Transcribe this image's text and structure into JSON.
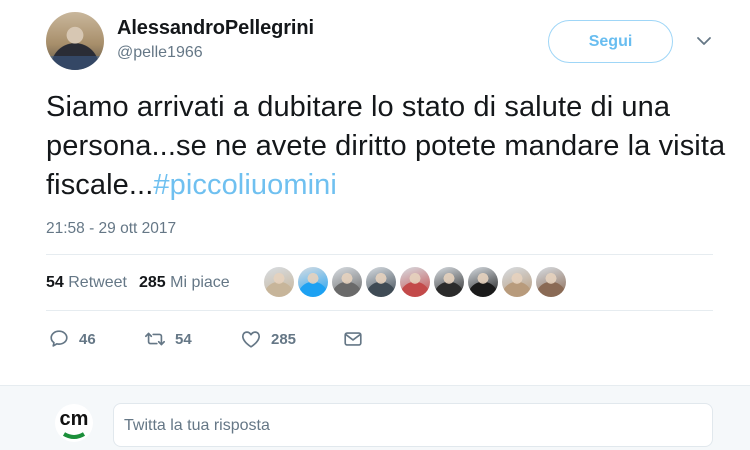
{
  "author": {
    "name": "AlessandroPellegrini",
    "handle": "@pelle1966"
  },
  "follow_button": {
    "label": "Segui"
  },
  "tweet": {
    "text_plain": "Siamo arrivati a dubitare lo stato di salute di una persona...se ne avete diritto potete mandare la visita fiscale...",
    "hashtag": "#piccoliuomini",
    "timestamp": "21:58 - 29 ott 2017"
  },
  "stats": {
    "retweets_count": "54",
    "retweets_label": "Retweet",
    "likes_count": "285",
    "likes_label": "Mi piace"
  },
  "likers": [
    {
      "icon": "user-avatar",
      "color": "#c7b59a"
    },
    {
      "icon": "user-avatar",
      "color": "#1da1f2"
    },
    {
      "icon": "user-avatar",
      "color": "#6a6a6a"
    },
    {
      "icon": "user-avatar",
      "color": "#3f4b55"
    },
    {
      "icon": "user-avatar",
      "color": "#c34a4a"
    },
    {
      "icon": "user-avatar",
      "color": "#2b2b2b"
    },
    {
      "icon": "user-avatar",
      "color": "#1a1a1a"
    },
    {
      "icon": "user-avatar",
      "color": "#b89b7c"
    },
    {
      "icon": "user-avatar",
      "color": "#8a6a55"
    }
  ],
  "actions": {
    "reply_count": "46",
    "retweet_count": "54",
    "like_count": "285"
  },
  "reply_box": {
    "placeholder": "Twitta la tua risposta",
    "avatar_text": "cm"
  },
  "colors": {
    "accent": "#1da1f2",
    "hashtag": "#6fc0f0",
    "muted": "#657786"
  }
}
